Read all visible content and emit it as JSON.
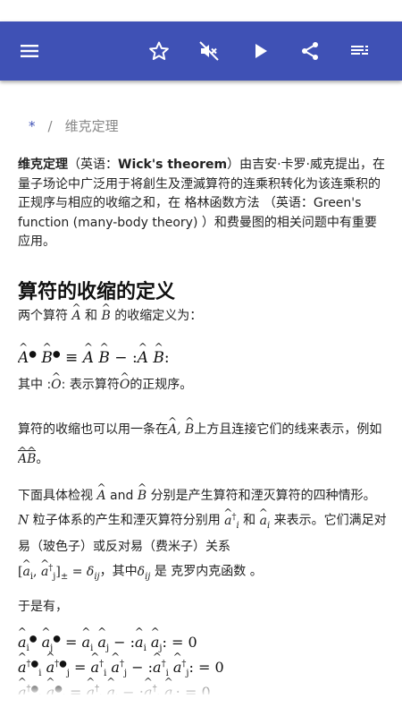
{
  "toolbar": {
    "menu_icon": "hamburger-menu-icon",
    "actions": [
      "star-icon",
      "volume-off-icon",
      "play-icon",
      "share-icon",
      "playlist-icon"
    ]
  },
  "breadcrumb": {
    "home": "*",
    "separator": "/",
    "current": "维克定理"
  },
  "intro": {
    "term": "维克定理",
    "p1": "（英语：",
    "english": "Wick's theorem",
    "p2": "）由吉安·卡罗·威克提出，在量子场论中广泛用于将創生及湮滅算符的连乘积转化为该连乘积的正规序与相应的收缩之和，在 格林函数方法 （英语：Green's function (many-body theory) ）和费曼图的相关问题中有重要应用。"
  },
  "section": {
    "title": "算符的收缩的定义",
    "line1a": "两个算符",
    "line1b": "和",
    "line1c": "的收缩定义为：",
    "formula1": "Â• B̂• ≡ Â B̂ − :Â B̂:",
    "line2a": "其中 :",
    "line2b": ": 表示算符",
    "line2c": "的正规序。",
    "para3a": "算符的收缩也可以用一条在",
    "para3b": "上方且连接它们的线来表示，例如",
    "para3c": "。",
    "para4a": "下面具体检视",
    "para4b": "and",
    "para4c": "分别是产生算符和湮灭算符的四种情形。",
    "para4d": "粒子体系的产生和湮灭算符分别用",
    "para4e": "和",
    "para4f": "来表示。它们满足对易（玻色子）或反对易（费米子）关系",
    "para4g": "，其中",
    "para4h": "是 克罗内克函数 。",
    "para5": "于是有，"
  }
}
